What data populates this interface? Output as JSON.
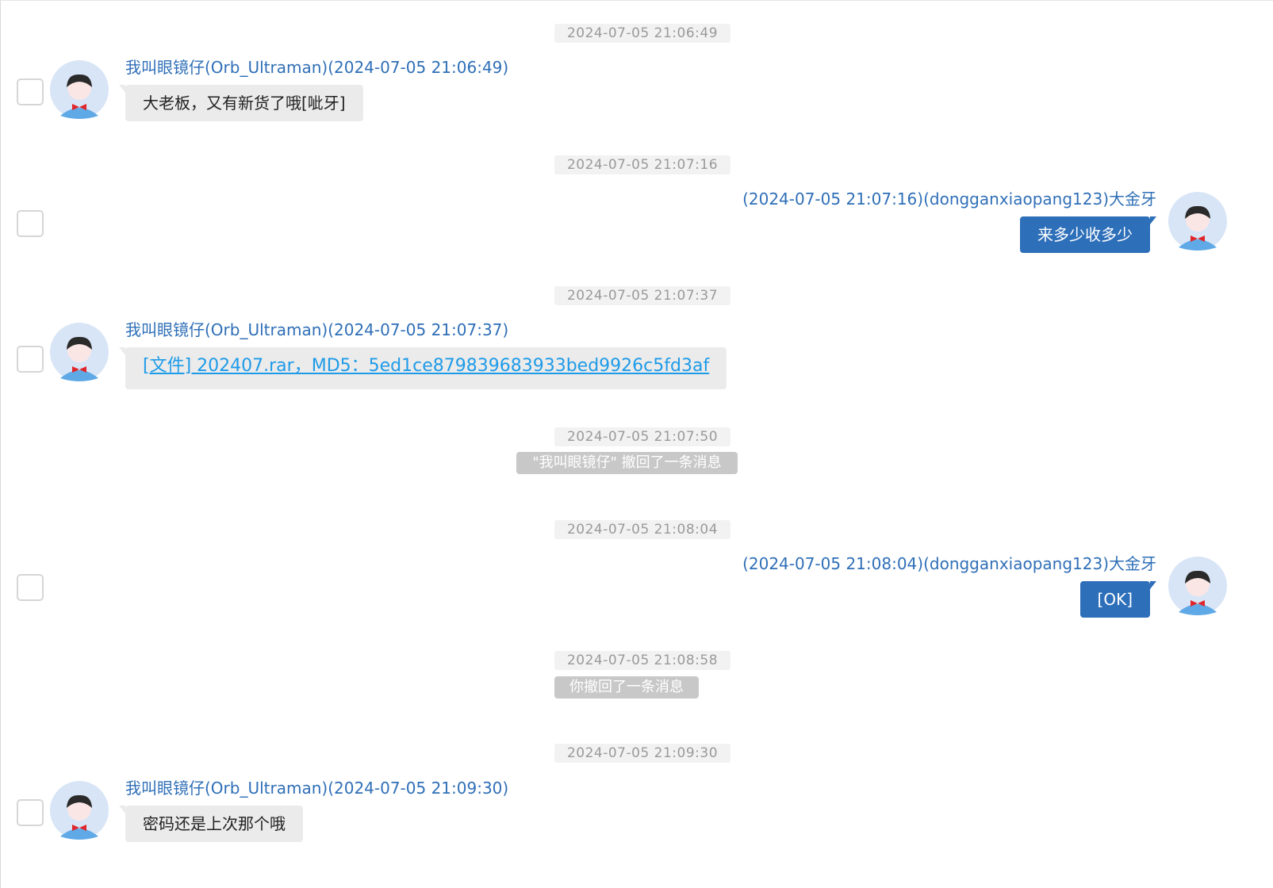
{
  "messages": [
    {
      "timestamp": "2024-07-05 21:06:49",
      "sender": "我叫眼镜仔(Orb_Ultraman)(2024-07-05 21:06:49)",
      "text": "大老板，又有新货了哦[呲牙]",
      "direction": "incoming"
    },
    {
      "timestamp": "2024-07-05 21:07:16",
      "sender": "(2024-07-05 21:07:16)(dongganxiaopang123)大金牙",
      "text": "来多少收多少",
      "direction": "outgoing"
    },
    {
      "timestamp": "2024-07-05 21:07:37",
      "sender": "我叫眼镜仔(Orb_Ultraman)(2024-07-05 21:07:37)",
      "text": "[文件] 202407.rar，MD5：5ed1ce879839683933bed9926c5fd3af",
      "direction": "incoming",
      "type": "file"
    },
    {
      "timestamp": "2024-07-05 21:07:50",
      "system": "\"我叫眼镜仔\" 撤回了一条消息"
    },
    {
      "timestamp": "2024-07-05 21:08:04",
      "sender": "(2024-07-05 21:08:04)(dongganxiaopang123)大金牙",
      "text": "[OK]",
      "direction": "outgoing"
    },
    {
      "timestamp": "2024-07-05 21:08:58",
      "system": "你撤回了一条消息"
    },
    {
      "timestamp": "2024-07-05 21:09:30",
      "sender": "我叫眼镜仔(Orb_Ultraman)(2024-07-05 21:09:30)",
      "text": "密码还是上次那个哦",
      "direction": "incoming"
    }
  ],
  "colors": {
    "sender_name": "#2f6fb7",
    "outgoing_bubble": "#2e6fba",
    "incoming_bubble": "#ebebeb",
    "file_link": "#1e9be8",
    "system_notice": "#c8c8c8"
  },
  "icons": {
    "avatar": "default-user-avatar-icon",
    "checkbox": "checkbox-icon"
  }
}
